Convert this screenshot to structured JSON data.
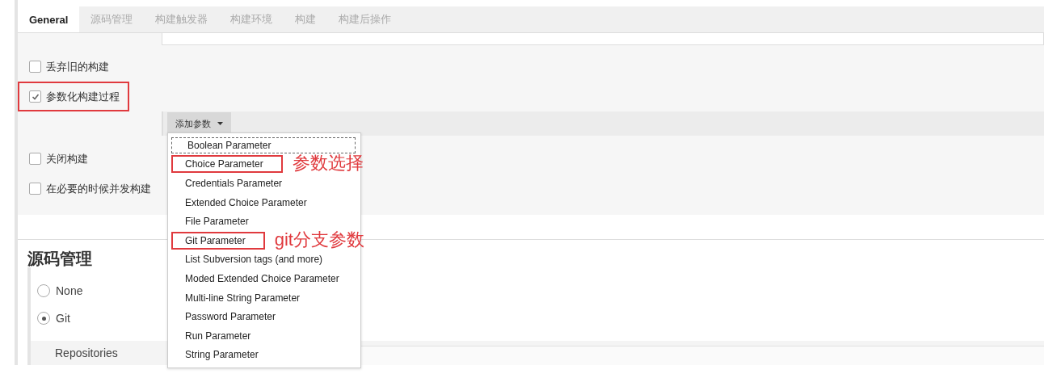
{
  "tabs": [
    {
      "label": "General",
      "selected": true
    },
    {
      "label": "源码管理",
      "selected": false
    },
    {
      "label": "构建触发器",
      "selected": false
    },
    {
      "label": "构建环境",
      "selected": false
    },
    {
      "label": "构建",
      "selected": false
    },
    {
      "label": "构建后操作",
      "selected": false
    }
  ],
  "options": [
    {
      "label": "丢弃旧的构建",
      "checked": false,
      "highlighted": false
    },
    {
      "label": "参数化构建过程",
      "checked": true,
      "highlighted": true
    }
  ],
  "add_parameter_button": {
    "label": "添加参数"
  },
  "more_options": [
    {
      "label": "关闭构建",
      "checked": false,
      "highlighted": false
    },
    {
      "label": "在必要的时候并发构建",
      "checked": false,
      "highlighted": false
    }
  ],
  "section": {
    "title": "源码管理"
  },
  "scm_options": [
    {
      "label": "None",
      "selected": false
    },
    {
      "label": "Git",
      "selected": true
    }
  ],
  "repositories": {
    "label": "Repositories"
  },
  "menu": {
    "items": [
      {
        "label": "Boolean Parameter",
        "focused": true
      },
      {
        "label": "Choice Parameter",
        "focused": false,
        "annotation": "参数选择"
      },
      {
        "label": "Credentials Parameter",
        "focused": false
      },
      {
        "label": "Extended Choice Parameter",
        "focused": false
      },
      {
        "label": "File Parameter",
        "focused": false
      },
      {
        "label": "Git Parameter",
        "focused": false,
        "annotation": "git分支参数"
      },
      {
        "label": "List Subversion tags (and more)",
        "focused": false
      },
      {
        "label": "Moded Extended Choice Parameter",
        "focused": false
      },
      {
        "label": "Multi-line String Parameter",
        "focused": false
      },
      {
        "label": "Password Parameter",
        "focused": false
      },
      {
        "label": "Run Parameter",
        "focused": false
      },
      {
        "label": "String Parameter",
        "focused": false
      }
    ]
  }
}
